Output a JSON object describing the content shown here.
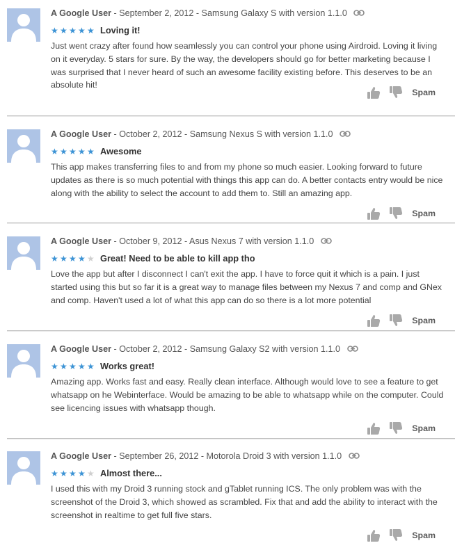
{
  "reviews": [
    {
      "author": "A Google User",
      "separator": " - ",
      "date": "September 2, 2012",
      "device": "Samsung Galaxy S with version 1.1.0",
      "rating": 5,
      "title": "Loving it!",
      "body": "Just went crazy after found how seamlessly you can control your phone using Airdroid. Loving it living on it everyday. 5 stars for sure. By the way, the developers should go for better marketing because I was surprised that I never heard of such an awesome facility existing before. This deserves to be an absolute hit!",
      "spam_label": "Spam"
    },
    {
      "author": "A Google User",
      "separator": " - ",
      "date": "October 2, 2012",
      "device": "Samsung Nexus S with version 1.1.0",
      "rating": 5,
      "title": "Awesome",
      "body": "This app makes transferring files to and from my phone so much easier. Looking forward to future updates as there is so much potential with things this app can do. A better contacts entry would be nice along with the ability to select the account to add them to. Still an amazing app.",
      "spam_label": "Spam"
    },
    {
      "author": "A Google User",
      "separator": " - ",
      "date": "October 9, 2012",
      "device": "Asus Nexus 7 with version 1.1.0",
      "rating": 4,
      "title": "Great! Need to be able to kill app tho",
      "body": "Love the app but after I disconnect I can't exit the app. I have to force quit it which is a pain. I just started using this but so far it is a great way to manage files between my Nexus 7 and comp and GNex and comp. Haven't used a lot of what this app can do so there is a lot more potential",
      "spam_label": "Spam"
    },
    {
      "author": "A Google User",
      "separator": " - ",
      "date": "October 2, 2012",
      "device": "Samsung Galaxy S2 with version 1.1.0",
      "rating": 5,
      "title": "Works great!",
      "body": "Amazing app. Works fast and easy. Really clean interface. Although would love to see a feature to get whatsapp on he Webinterface. Would be amazing to be able to whatsapp while on the computer. Could see licencing issues with whatsapp though.",
      "spam_label": "Spam"
    },
    {
      "author": "A Google User",
      "separator": " - ",
      "date": "September 26, 2012",
      "device": "Motorola Droid 3 with version 1.1.0",
      "rating": 4,
      "title": "Almost there...",
      "body": "I used this with my Droid 3 running stock and gTablet running ICS. The only problem was with the screenshot of the Droid 3, which showed as scrambled. Fix that and add the ability to interact with the screenshot in realtime to get full five stars.",
      "spam_label": "Spam"
    }
  ],
  "icons": {
    "avatar": "default-user-avatar",
    "permalink": "link-icon",
    "thumbs_up": "thumbs-up-icon",
    "thumbs_down": "thumbs-down-icon",
    "star": "star-icon"
  },
  "colors": {
    "star_on": "#3c93d5",
    "star_off": "#cfcfcf",
    "avatar_bg": "#aec4e6",
    "avatar_fg": "#ffffff"
  }
}
